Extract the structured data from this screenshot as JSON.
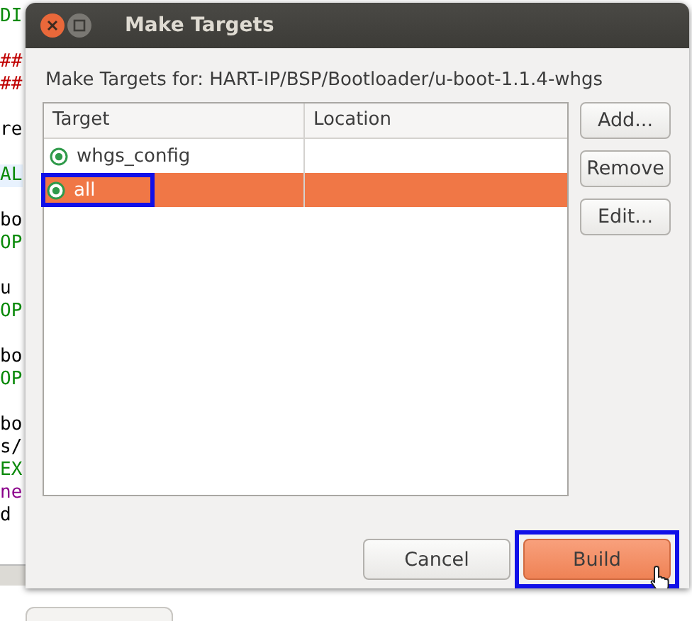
{
  "editor": {
    "lines": [
      {
        "kind": "text",
        "text": "DI",
        "color": "#0a8a0a"
      },
      {
        "kind": "blank"
      },
      {
        "kind": "text",
        "text": "##",
        "color": "#c00000"
      },
      {
        "kind": "text",
        "text": "##",
        "color": "#c00000"
      },
      {
        "kind": "blank"
      },
      {
        "kind": "text",
        "text": "re",
        "color": "#000000"
      },
      {
        "kind": "blank"
      },
      {
        "kind": "text",
        "text": "AL",
        "color": "#0a8a0a",
        "highlighted": true
      },
      {
        "kind": "blank"
      },
      {
        "kind": "text",
        "text": "bo",
        "color": "#000000"
      },
      {
        "kind": "text",
        "text": "OP",
        "color": "#0a8a0a"
      },
      {
        "kind": "blank"
      },
      {
        "kind": "text",
        "text": "u",
        "color": "#000000"
      },
      {
        "kind": "text",
        "text": "OP",
        "color": "#0a8a0a"
      },
      {
        "kind": "blank"
      },
      {
        "kind": "text",
        "text": "bo",
        "color": "#000000"
      },
      {
        "kind": "text",
        "text": "OP",
        "color": "#0a8a0a"
      },
      {
        "kind": "blank"
      },
      {
        "kind": "text",
        "text": "bo",
        "color": "#000000"
      },
      {
        "kind": "text",
        "text": "s/",
        "color": "#000000"
      },
      {
        "kind": "text",
        "text": "EX",
        "color": "#0a8a0a"
      },
      {
        "kind": "text",
        "text": "ne",
        "color": "#8b008b"
      },
      {
        "kind": "text",
        "text": "d",
        "color": "#000000"
      }
    ]
  },
  "dialog": {
    "title": "Make Targets",
    "heading": "Make Targets for: HART-IP/BSP/Bootloader/u-boot-1.1.4-whgs",
    "table": {
      "columns": [
        "Target",
        "Location"
      ],
      "rows": [
        {
          "target": "whgs_config",
          "selected": false
        },
        {
          "target": "all",
          "selected": true
        }
      ]
    },
    "side_buttons": [
      "Add...",
      "Remove",
      "Edit..."
    ],
    "buttons": [
      {
        "label": "Cancel",
        "default": false
      },
      {
        "label": "Build",
        "default": true
      }
    ]
  }
}
